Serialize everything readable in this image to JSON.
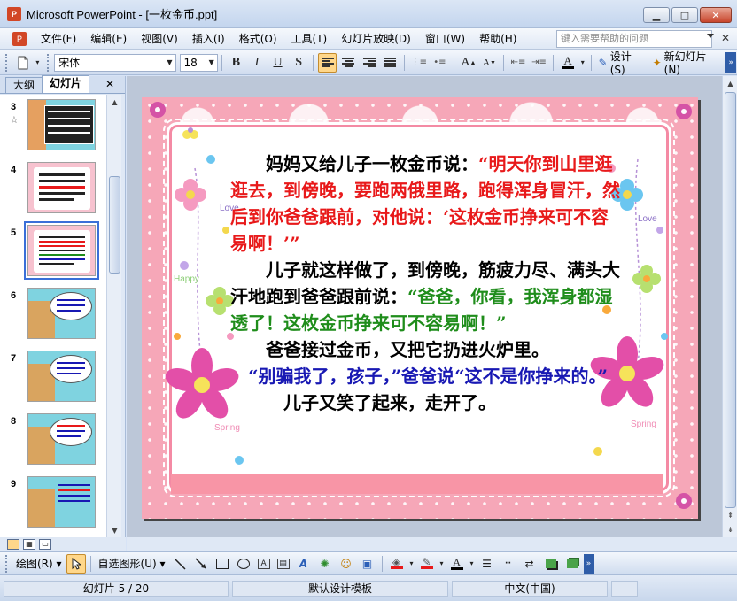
{
  "window": {
    "title": "Microsoft PowerPoint - [一枚金币.ppt]",
    "app_icon_text": "P"
  },
  "menu": {
    "items": [
      "文件(F)",
      "编辑(E)",
      "视图(V)",
      "插入(I)",
      "格式(O)",
      "工具(T)",
      "幻灯片放映(D)",
      "窗口(W)",
      "帮助(H)"
    ],
    "help_placeholder": "键入需要帮助的问题"
  },
  "toolbar": {
    "font_name": "宋体",
    "font_size": "18",
    "bold": "B",
    "italic": "I",
    "underline": "U",
    "shadow": "S",
    "design_label": "设计(S)",
    "new_slide_label": "新幻灯片(N)"
  },
  "panel": {
    "tabs": [
      "大纲",
      "幻灯片"
    ],
    "active_tab": "幻灯片",
    "thumbnails": [
      {
        "num": "3",
        "has_star": true,
        "style": "table"
      },
      {
        "num": "4",
        "has_star": false,
        "style": "pink-text"
      },
      {
        "num": "5",
        "has_star": false,
        "style": "pink-text",
        "selected": true
      },
      {
        "num": "6",
        "has_star": false,
        "style": "bubble"
      },
      {
        "num": "7",
        "has_star": false,
        "style": "bubble"
      },
      {
        "num": "8",
        "has_star": false,
        "style": "bubble"
      },
      {
        "num": "9",
        "has_star": false,
        "style": "list"
      }
    ]
  },
  "slide": {
    "paragraphs": [
      {
        "lead": "　　妈妈又给儿子一枚金币说：",
        "quote": "“明天你到山里逛逛去，到傍晚，要跑两俄里路，跑得浑身冒汗，然后到你爸爸跟前，对他说：‘这枚金币挣来可不容易啊！’”",
        "quote_color": "red"
      },
      {
        "lead": "　　儿子就这样做了，到傍晚，筋疲力尽、满头大汗地跑到爸爸跟前说：",
        "quote": "“爸爸，你看，我浑身都湿透了！这枚金币挣来可不容易啊！”",
        "quote_color": "green"
      },
      {
        "lead": "　　爸爸接过金币，又把它扔进火炉里。",
        "quote": "",
        "quote_color": ""
      },
      {
        "lead": "",
        "quote": "　“别骗我了，孩子，”爸爸说“这不是你挣来的。”",
        "quote_color": "blue"
      },
      {
        "lead": "　　　儿子又笑了起来，走开了。",
        "quote": "",
        "quote_color": ""
      }
    ],
    "deco_words": [
      "Happy",
      "Love",
      "Spring",
      "Spring",
      "Love"
    ]
  },
  "drawbar": {
    "draw_label": "绘图(R)",
    "autoshapes_label": "自选图形(U)"
  },
  "status": {
    "slide_info": "幻灯片 5 / 20",
    "template": "默认设计模板",
    "language": "中文(中国)"
  },
  "colors": {
    "quote_red": "#e8191a",
    "quote_green": "#1f8d1b",
    "quote_blue": "#1818b3",
    "slide_pink": "#f6a7b8"
  }
}
